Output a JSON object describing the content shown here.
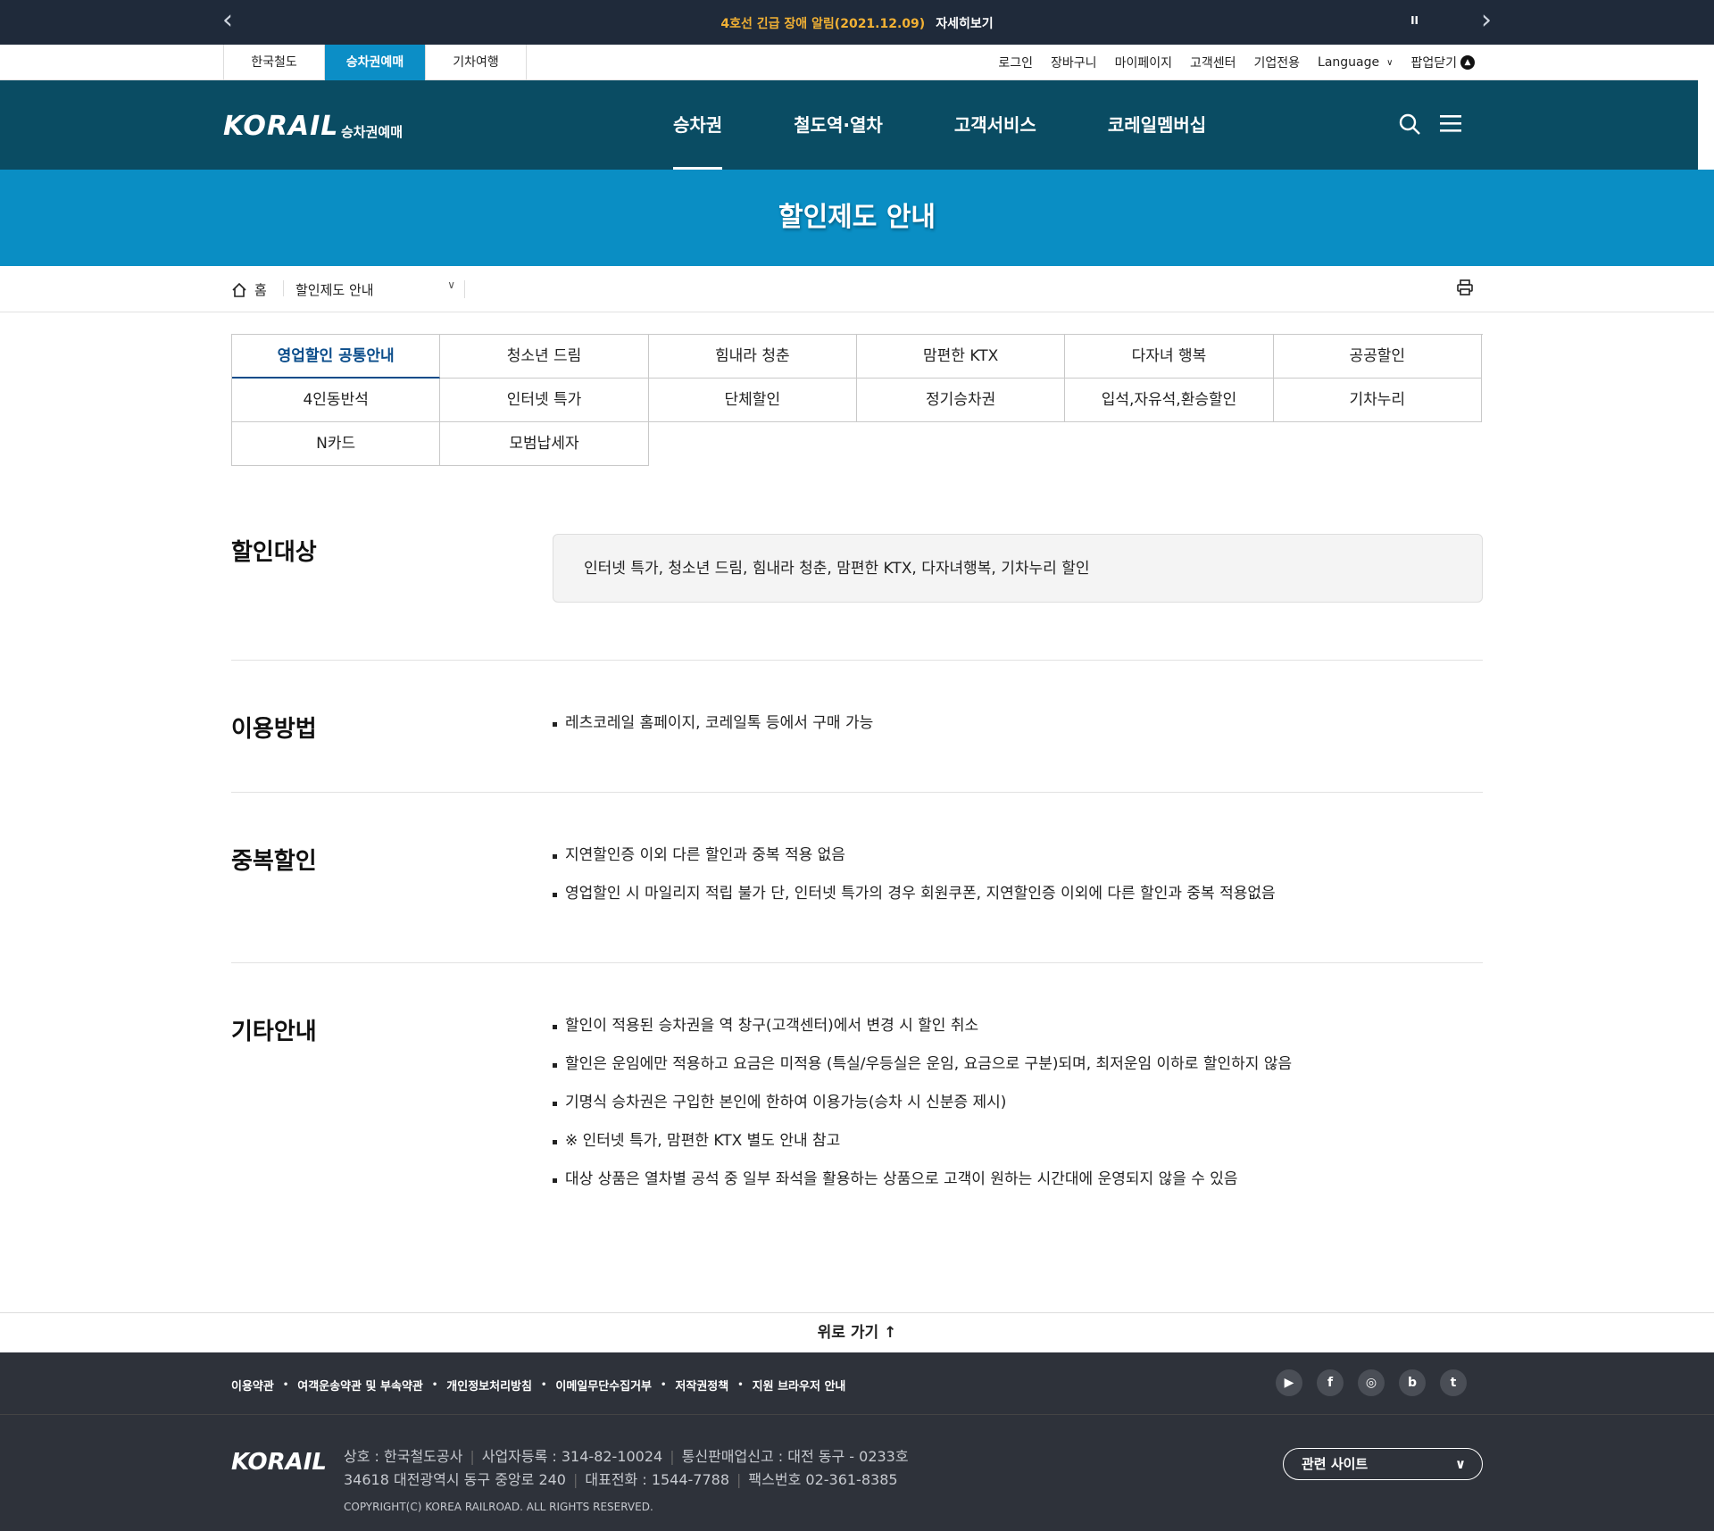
{
  "notice": {
    "text": "4호선 긴급 장애 알림(2021.12.09)",
    "more": "자세히보기",
    "pause": "II",
    "prev": "‹",
    "next": "›"
  },
  "util": {
    "tabs": [
      "한국철도",
      "승차권예매",
      "기차여행"
    ],
    "links": {
      "login": "로그인",
      "cart": "장바구니",
      "mypage": "마이페이지",
      "center": "고객센터",
      "corp": "기업전용",
      "language": "Language",
      "popup": "팝업닫기"
    }
  },
  "gnb": {
    "logo": "KORAIL",
    "logo_sub": "승차권예매",
    "menu": [
      "승차권",
      "철도역·열차",
      "고객서비스",
      "코레일멤버십"
    ]
  },
  "page_title": "할인제도 안내",
  "location": {
    "home": "홈",
    "current": "할인제도 안내"
  },
  "tabs": [
    "영업할인 공통안내",
    "청소년 드림",
    "힘내라 청춘",
    "맘편한 KTX",
    "다자녀 행복",
    "공공할인",
    "4인동반석",
    "인터넷 특가",
    "단체할인",
    "정기승차권",
    "입석,자유석,환승할인",
    "기차누리",
    "N카드",
    "모범납세자"
  ],
  "sections": {
    "target": {
      "title": "할인대상",
      "text": "인터넷 특가, 청소년 드림, 힘내라 청춘, 맘편한 KTX, 다자녀행복, 기차누리 할인"
    },
    "usage": {
      "title": "이용방법",
      "items": [
        "레츠코레일 홈페이지, 코레일톡 등에서 구매 가능"
      ]
    },
    "duplicate": {
      "title": "중복할인",
      "items": [
        "지연할인증 이외 다른 할인과 중복 적용 없음",
        "영업할인 시 마일리지 적립 불가 단, 인터넷 특가의 경우 회원쿠폰, 지연할인증 이외에 다른 할인과 중복 적용없음"
      ]
    },
    "etc": {
      "title": "기타안내",
      "items": [
        "할인이 적용된 승차권을 역 창구(고객센터)에서 변경 시 할인 취소",
        "할인은 운임에만 적용하고 요금은 미적용 (특실/우등실은 운임, 요금으로 구분)되며, 최저운임 이하로 할인하지 않음",
        "기명식 승차권은 구입한 본인에 한하여 이용가능(승차 시 신분증 제시)",
        "※ 인터넷 특가, 맘편한 KTX 별도 안내 참고",
        "대상 상품은 열차별 공석 중 일부 좌석을 활용하는 상품으로 고객이 원하는 시간대에 운영되지 않을 수 있음"
      ]
    }
  },
  "top_button": "위로 가기 ↑",
  "footer": {
    "links": [
      "이용약관",
      "여객운송약관 및 부속약관",
      "개인정보처리방침",
      "이메일무단수집거부",
      "저작권정책",
      "지원 브라우저 안내"
    ],
    "sns": [
      "youtube-icon",
      "facebook-icon",
      "instagram-icon",
      "blog-icon",
      "twitter-icon"
    ],
    "logo": "KORAIL",
    "info1": [
      "상호 : 한국철도공사",
      "사업자등록 : 314-82-10024",
      "통신판매업신고 : 대전 동구 - 0233호"
    ],
    "info2": [
      "34618 대전광역시 동구 중앙로 240",
      "대표전화 : 1544-7788",
      "팩스번호 02-361-8385"
    ],
    "copyright": "COPYRIGHT(C) KOREA RAILROAD. ALL RIGHTS RESERVED.",
    "related": "관련 사이트"
  }
}
